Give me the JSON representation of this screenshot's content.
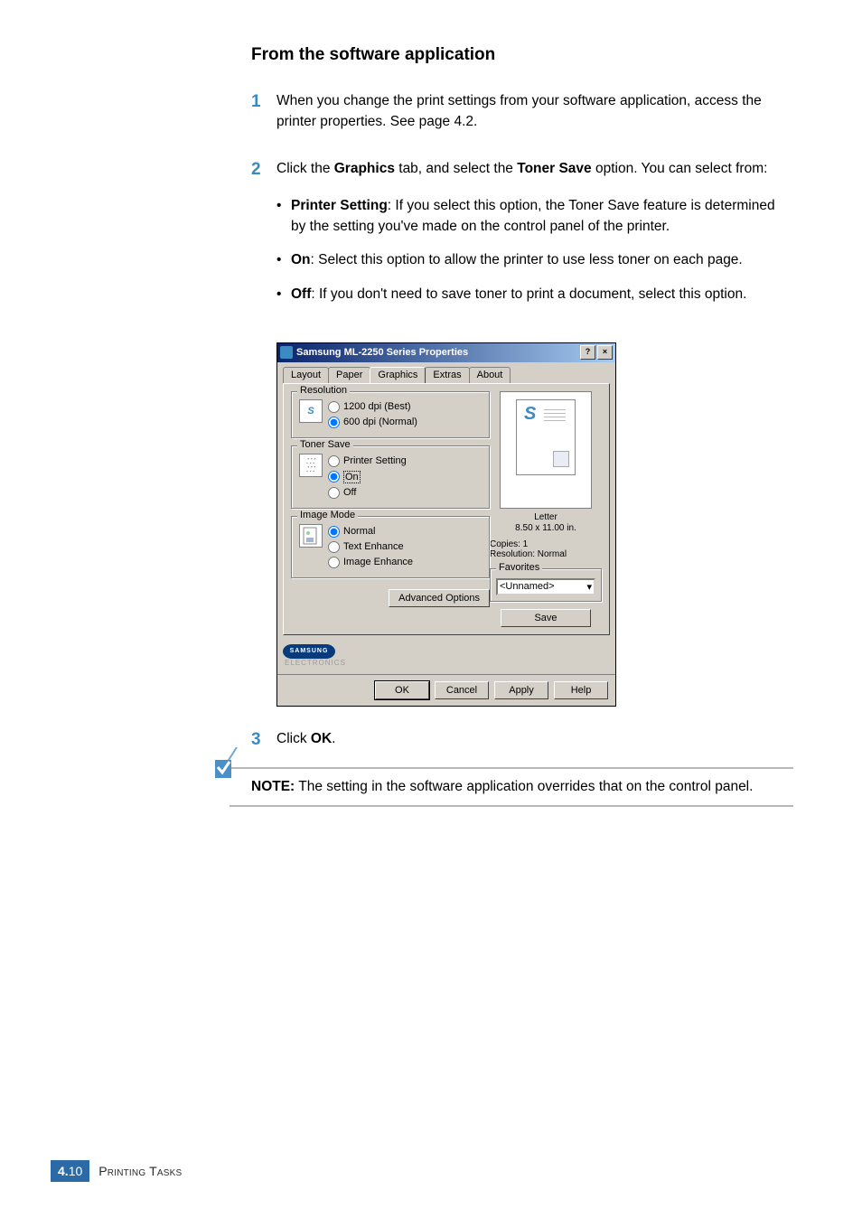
{
  "heading": "From the software application",
  "step1": {
    "num": "1",
    "text": "When you change the print settings from your software application, access the printer properties. See page 4.2."
  },
  "step2": {
    "num": "2",
    "intro_a": "Click the ",
    "intro_b": " tab, and select the ",
    "intro_c": " option. You can select from:",
    "graphics_word": "Graphics",
    "tonersave_word": "Toner Save",
    "b1_label": "Printer Setting",
    "b1_text": ": If you select this option, the Toner Save feature is determined by the setting you've made on the control panel of the printer.",
    "b2_label": "On",
    "b2_text": ": Select this option to allow the printer to use less toner on each page.",
    "b3_label": "Off",
    "b3_text": ": If you don't need to save toner to print a document, select this option."
  },
  "step3": {
    "num": "3",
    "intro": "Click ",
    "ok_word": "OK",
    "period": "."
  },
  "note": {
    "label": "NOTE:",
    "text": " The setting in the software application overrides that on the control panel."
  },
  "footer": {
    "page_chapter": "4.",
    "page_num": "10",
    "section": "Printing Tasks"
  },
  "dialog": {
    "title": "Samsung ML-2250 Series Properties",
    "help_icon": "?",
    "close_icon": "×",
    "tabs": {
      "layout": "Layout",
      "paper": "Paper",
      "graphics": "Graphics",
      "extras": "Extras",
      "about": "About"
    },
    "resolution": {
      "title": "Resolution",
      "opt1": "1200 dpi (Best)",
      "opt2": "600 dpi (Normal)",
      "icon": "S"
    },
    "tonersave": {
      "title": "Toner Save",
      "opt1": "Printer Setting",
      "opt2": "On",
      "opt3": "Off"
    },
    "imagemode": {
      "title": "Image Mode",
      "opt1": "Normal",
      "opt2": "Text Enhance",
      "opt3": "Image Enhance"
    },
    "advanced_btn": "Advanced Options",
    "page_label": "Letter",
    "page_dim": "8.50 x 11.00 in.",
    "copies": "Copies: 1",
    "res_status": "Resolution: Normal",
    "favorites": {
      "title": "Favorites",
      "value": "<Unnamed>"
    },
    "save_btn": "Save",
    "logo": {
      "brand": "SAMSUNG",
      "sub": "ELECTRONICS"
    },
    "buttons": {
      "ok": "OK",
      "cancel": "Cancel",
      "apply": "Apply",
      "help": "Help"
    }
  }
}
